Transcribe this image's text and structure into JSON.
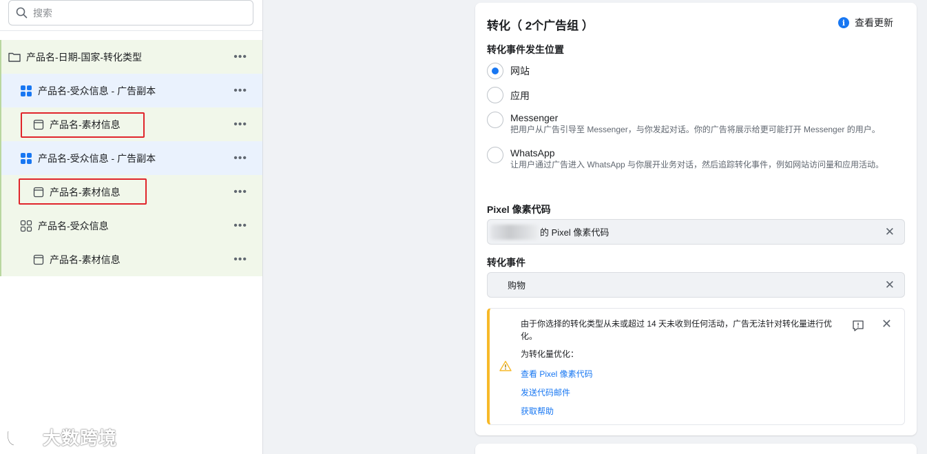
{
  "search": {
    "placeholder": "搜索"
  },
  "tree": {
    "campaign": "产品名-日期-国家-转化类型",
    "adset_1": "产品名-受众信息 - 广告副本",
    "ad_1": "产品名-素材信息",
    "adset_2": "产品名-受众信息 - 广告副本",
    "ad_2": "产品名-素材信息",
    "adset_3": "产品名-受众信息",
    "ad_3": "产品名-素材信息",
    "more": "•••"
  },
  "watermark": {
    "text": "大数跨境"
  },
  "panel": {
    "title": "转化（ 2个广告组 ）",
    "updates_label": "查看更新",
    "location_title": "转化事件发生位置",
    "options": [
      {
        "label": "网站",
        "desc": "",
        "selected": true
      },
      {
        "label": "应用",
        "desc": "",
        "selected": false
      },
      {
        "label": "Messenger",
        "desc": "把用户从广告引导至 Messenger，与你发起对话。你的广告将展示给更可能打开 Messenger 的用户。",
        "selected": false
      },
      {
        "label": "WhatsApp",
        "desc": "让用户通过广告进入 WhatsApp 与你展开业务对话，然后追踪转化事件，例如网站访问量和应用活动。",
        "selected": false
      }
    ],
    "pixel_title": "Pixel 像素代码",
    "pixel_value": "的 Pixel 像素代码",
    "event_title": "转化事件",
    "event_value": "购物",
    "warning": {
      "text": "由于你选择的转化类型从未或超过 14 天未收到任何活动，广告无法针对转化量进行优化。",
      "sub": "为转化量优化：",
      "link_1": "查看 Pixel 像素代码",
      "link_2": "发送代码邮件",
      "link_3": "获取帮助"
    }
  },
  "colors": {
    "accent": "#1877f2",
    "warning": "#f7b928",
    "highlight": "#e0242a"
  }
}
